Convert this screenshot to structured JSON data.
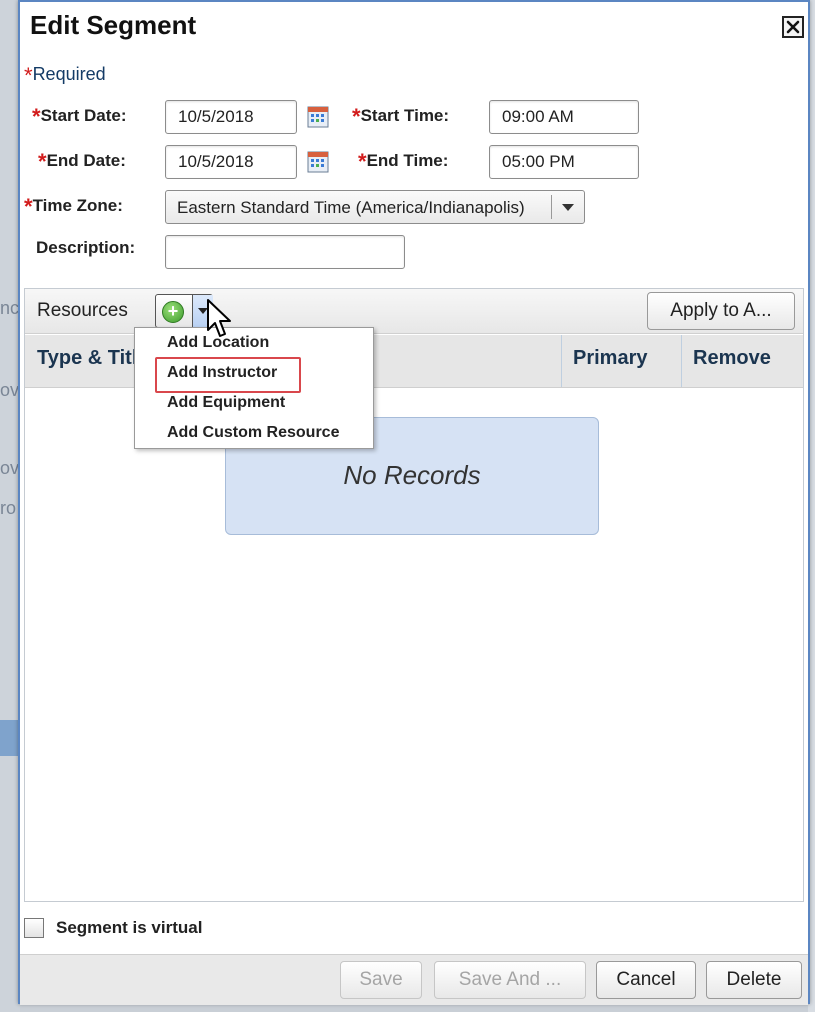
{
  "background": {
    "left_text_1": "nc",
    "left_text_2": "ov",
    "left_text_3": "ov",
    "left_text_4": "ro"
  },
  "dialog": {
    "title": "Edit Segment",
    "close_icon": "close-x-icon",
    "required_star": "*",
    "required_label": "Required"
  },
  "form": {
    "start_date_label": "Start Date:",
    "start_date_value": "10/5/2018",
    "start_time_label": "Start Time:",
    "start_time_value": "09:00 AM",
    "end_date_label": "End Date:",
    "end_date_value": "10/5/2018",
    "end_time_label": "End Time:",
    "end_time_value": "05:00 PM",
    "time_zone_label": "Time Zone:",
    "time_zone_value": "Eastern Standard Time (America/Indianapolis)",
    "description_label": "Description:",
    "description_value": ""
  },
  "resources": {
    "label": "Resources",
    "apply_button": "Apply to A...",
    "columns": [
      "Type & Title",
      "Primary",
      "Remove"
    ],
    "empty_text": "No Records",
    "menu": [
      "Add Location",
      "Add Instructor",
      "Add Equipment",
      "Add Custom Resource"
    ]
  },
  "footer": {
    "virtual_label": "Segment is virtual",
    "save": "Save",
    "save_and": "Save And ...",
    "cancel": "Cancel",
    "delete": "Delete"
  },
  "colors": {
    "accent_border": "#5b86c2",
    "required_star": "#d21c1c",
    "highlight_red": "#d9474c",
    "empty_state_bg": "#d6e2f4"
  }
}
